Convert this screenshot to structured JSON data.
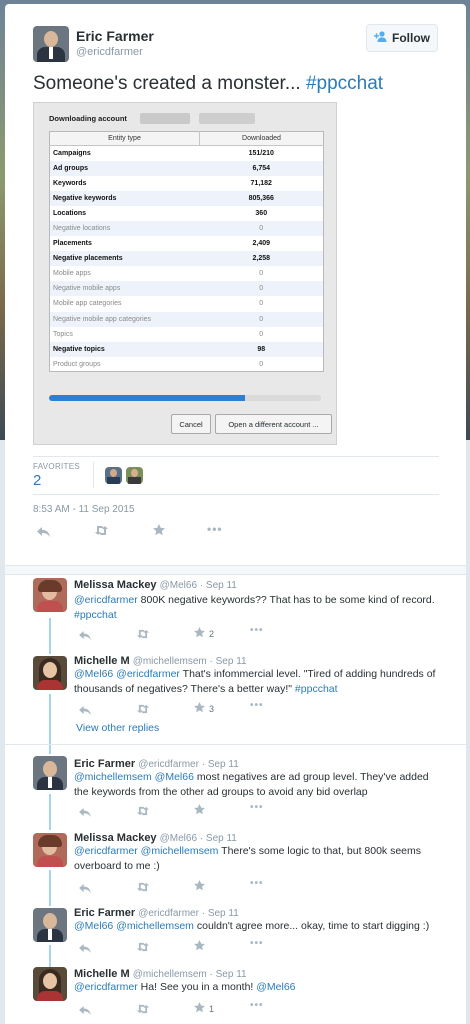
{
  "tweet": {
    "author_name": "Eric Farmer",
    "author_handle": "@ericdfarmer",
    "follow_label": "Follow",
    "text_plain": "Someone's created a monster... ",
    "text_hashtag": "#ppcchat",
    "favorites_label": "FAVORITES",
    "favorites_count": "2",
    "timestamp": "8:53 AM - 11 Sep 2015"
  },
  "screenshot": {
    "title": "Downloading account",
    "col_entity": "Entity type",
    "col_downloaded": "Downloaded",
    "rows": [
      {
        "name": "Campaigns",
        "value": "151/210",
        "bold": true
      },
      {
        "name": "Ad groups",
        "value": "6,754",
        "bold": true
      },
      {
        "name": "Keywords",
        "value": "71,182",
        "bold": true
      },
      {
        "name": "Negative keywords",
        "value": "805,366",
        "bold": true
      },
      {
        "name": "Locations",
        "value": "360",
        "bold": true
      },
      {
        "name": "Negative locations",
        "value": "0",
        "bold": false
      },
      {
        "name": "Placements",
        "value": "2,409",
        "bold": true
      },
      {
        "name": "Negative placements",
        "value": "2,258",
        "bold": true
      },
      {
        "name": "Mobile apps",
        "value": "0",
        "bold": false
      },
      {
        "name": "Negative mobile apps",
        "value": "0",
        "bold": false
      },
      {
        "name": "Mobile app categories",
        "value": "0",
        "bold": false
      },
      {
        "name": "Negative mobile app categories",
        "value": "0",
        "bold": false
      },
      {
        "name": "Topics",
        "value": "0",
        "bold": false
      },
      {
        "name": "Negative topics",
        "value": "98",
        "bold": true
      },
      {
        "name": "Product groups",
        "value": "0",
        "bold": false
      }
    ],
    "progress": 0.72,
    "cancel_label": "Cancel",
    "open_label": "Open a different account ..."
  },
  "replies": [
    {
      "name": "Melissa Mackey",
      "meta": "@Mel66 · Sep 11",
      "mentions": "@ericdfarmer",
      "text": " 800K negative keywords?? That has to be some kind of record.",
      "hashtag": "#ppcchat",
      "fav_count": "2"
    },
    {
      "name": "Michelle M",
      "meta": "@michellemsem · Sep 11",
      "mentions": "@Mel66 @ericdfarmer",
      "text": " That's infommercial level. \"Tired of adding hundreds of thousands of negatives? There's a better way!\" ",
      "hashtag": "#ppcchat",
      "fav_count": "3"
    },
    {
      "name": "Eric Farmer",
      "meta": "@ericdfarmer · Sep 11",
      "mentions": "@michellemsem @Mel66",
      "text": " most negatives are ad group level. They've added the keywords from the other ad groups to avoid any bid overlap"
    },
    {
      "name": "Melissa Mackey",
      "meta": "@Mel66 · Sep 11",
      "mentions": "@ericdfarmer @michellemsem",
      "text": " There's some logic to that, but 800k seems overboard to me :)"
    },
    {
      "name": "Eric Farmer",
      "meta": "@ericdfarmer · Sep 11",
      "mentions": "@Mel66 @michellemsem",
      "text": " couldn't agree more... okay, time to start digging :)"
    },
    {
      "name": "Michelle M",
      "meta": "@michellemsem · Sep 11",
      "mentions": "@ericdfarmer",
      "text": " Ha! See you in a month! ",
      "tail_mention": "@Mel66",
      "fav_count": "1"
    }
  ],
  "view_other_replies": "View other replies",
  "icons": {
    "reply": "reply-icon",
    "retweet": "retweet-icon",
    "favorite": "star-icon",
    "more": "more-icon"
  },
  "colors": {
    "link": "#2b7bb9",
    "thread": "#a7d4f1",
    "action": "#aab8c2"
  }
}
